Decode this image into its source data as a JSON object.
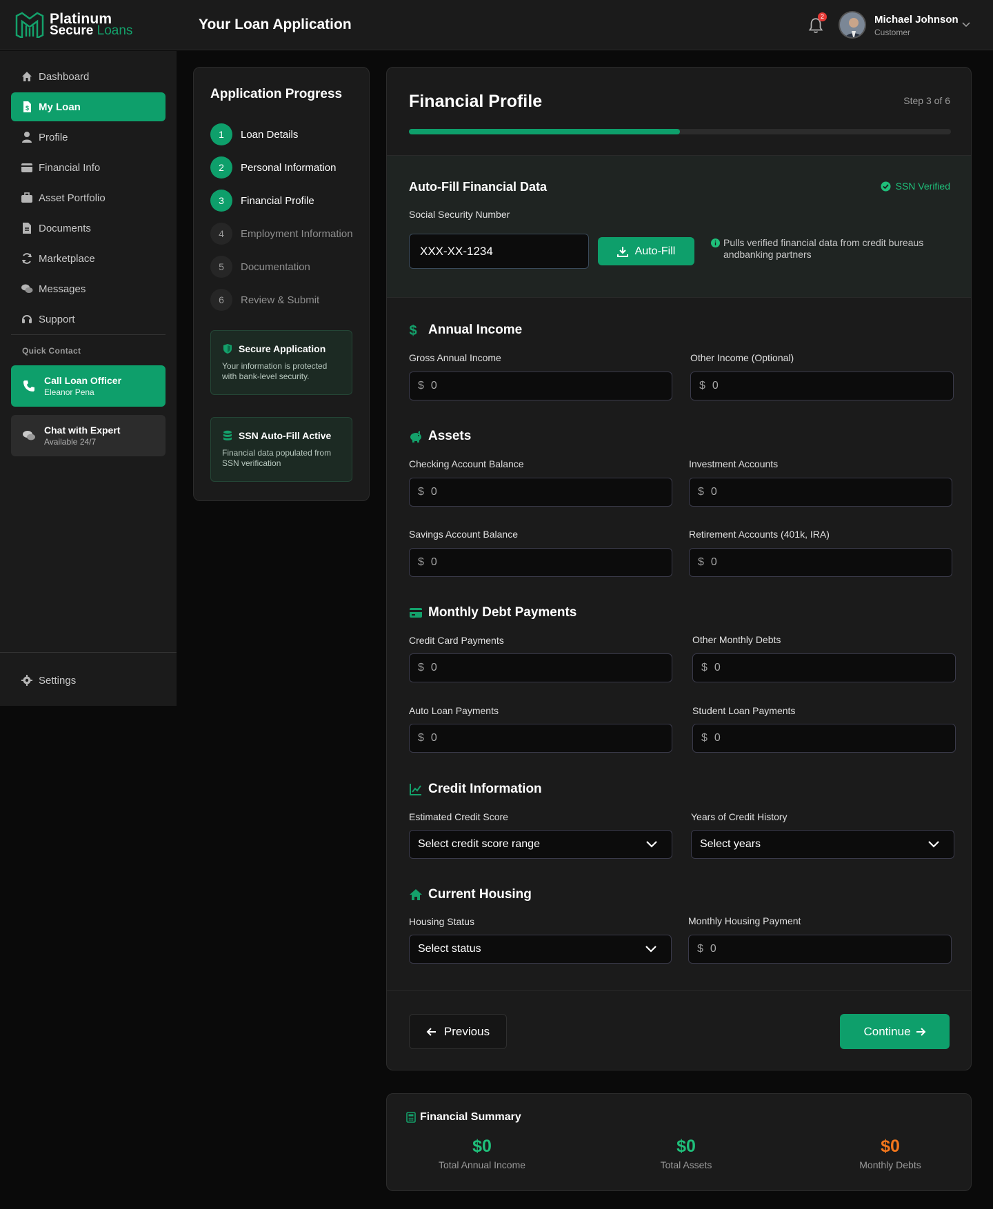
{
  "brand": {
    "line1": "Platinum",
    "line2a": "Secure",
    "line2b": "Loans"
  },
  "header": {
    "title": "Your Loan Application",
    "notification_count": "2",
    "user_name": "Michael Johnson",
    "user_role": "Customer"
  },
  "sidebar": {
    "items": [
      {
        "label": "Dashboard",
        "icon": "home-icon"
      },
      {
        "label": "My Loan",
        "icon": "loan-doc-icon",
        "active": true
      },
      {
        "label": "Profile",
        "icon": "user-icon"
      },
      {
        "label": "Financial Info",
        "icon": "wallet-icon"
      },
      {
        "label": "Asset Portfolio",
        "icon": "briefcase-icon"
      },
      {
        "label": "Documents",
        "icon": "document-icon"
      },
      {
        "label": "Marketplace",
        "icon": "sync-icon"
      },
      {
        "label": "Messages",
        "icon": "chat-icon"
      },
      {
        "label": "Support",
        "icon": "headset-icon"
      }
    ],
    "quick_contact_label": "Quick Contact",
    "call_title": "Call Loan Officer",
    "call_sub": "Eleanor Pena",
    "chat_title": "Chat with Expert",
    "chat_sub": "Available 24/7",
    "settings_label": "Settings"
  },
  "progress": {
    "title": "Application Progress",
    "steps": [
      {
        "num": "1",
        "label": "Loan Details",
        "done": true
      },
      {
        "num": "2",
        "label": "Personal Information",
        "done": true
      },
      {
        "num": "3",
        "label": "Financial Profile",
        "done": true
      },
      {
        "num": "4",
        "label": "Employment Information",
        "done": false
      },
      {
        "num": "5",
        "label": "Documentation",
        "done": false
      },
      {
        "num": "6",
        "label": "Review & Submit",
        "done": false
      }
    ],
    "secure_title": "Secure Application",
    "secure_body": "Your information is protected with bank-level security.",
    "ssn_title": "SSN Auto-Fill Active",
    "ssn_body": "Financial data populated from SSN verification"
  },
  "form": {
    "title": "Financial Profile",
    "step_text": "Step 3 of 6",
    "progress_fraction": 0.5,
    "autofill": {
      "title": "Auto-Fill Financial Data",
      "verified": "SSN Verified",
      "ssn_label": "Social Security Number",
      "ssn_value": "XXX-XX-1234",
      "button": "Auto-Fill",
      "note": "Pulls verified financial data from credit bureaus andbanking partners"
    },
    "currency": "$",
    "annual_income": {
      "title": "Annual Income",
      "gross_label": "Gross Annual Income",
      "gross_value": "0",
      "other_label": "Other Income (Optional)",
      "other_value": "0"
    },
    "assets": {
      "title": "Assets",
      "checking_label": "Checking Account Balance",
      "checking_value": "0",
      "investment_label": "Investment Accounts",
      "investment_value": "0",
      "savings_label": "Savings Account Balance",
      "savings_value": "0",
      "retirement_label": "Retirement Accounts (401k, IRA)",
      "retirement_value": "0"
    },
    "debts": {
      "title": "Monthly Debt Payments",
      "credit_label": "Credit Card Payments",
      "credit_value": "0",
      "other_label": "Other Monthly Debts",
      "other_value": "0",
      "auto_label": "Auto Loan Payments",
      "auto_value": "0",
      "student_label": "Student Loan Payments",
      "student_value": "0"
    },
    "credit": {
      "title": "Credit Information",
      "score_label": "Estimated Credit Score",
      "score_value": "Select credit score range",
      "years_label": "Years of Credit History",
      "years_value": "Select years"
    },
    "housing": {
      "title": "Current Housing",
      "status_label": "Housing Status",
      "status_value": "Select status",
      "payment_label": "Monthly Housing Payment",
      "payment_value": "0"
    },
    "prev_label": "Previous",
    "next_label": "Continue"
  },
  "summary": {
    "title": "Financial Summary",
    "income_value": "$0",
    "income_label": "Total Annual Income",
    "assets_value": "$0",
    "assets_label": "Total Assets",
    "debts_value": "$0",
    "debts_label": "Monthly Debts"
  },
  "colors": {
    "accent": "#0e9f6b",
    "debt": "#f2761c",
    "income": "#1fbf7a"
  }
}
